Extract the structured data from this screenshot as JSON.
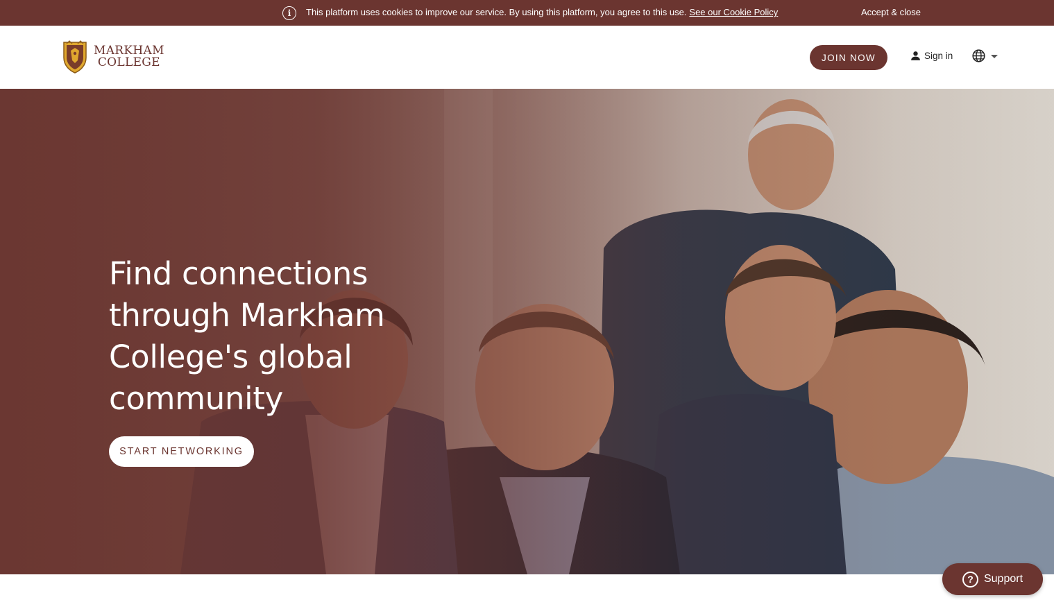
{
  "cookie_bar": {
    "message": "This platform uses cookies to improve our service. By using this platform, you agree to this use.",
    "policy_link": "See our Cookie Policy",
    "accept_label": "Accept & close",
    "info_icon": "info-icon"
  },
  "header": {
    "logo": {
      "line1": "MARKHAM",
      "line2": "COLLEGE",
      "crest_icon": "crest-icon"
    },
    "join_label": "JOIN NOW",
    "signin_label": "Sign in",
    "signin_icon": "user-icon",
    "language_icon": "globe-icon"
  },
  "hero": {
    "title": "Find connections through Markham College's global community",
    "cta_label": "START NETWORKING"
  },
  "support": {
    "label": "Support",
    "icon": "question-circle-icon"
  },
  "colors": {
    "brand": "#6b3530",
    "white": "#ffffff",
    "crest_gold": "#e0a82e"
  }
}
